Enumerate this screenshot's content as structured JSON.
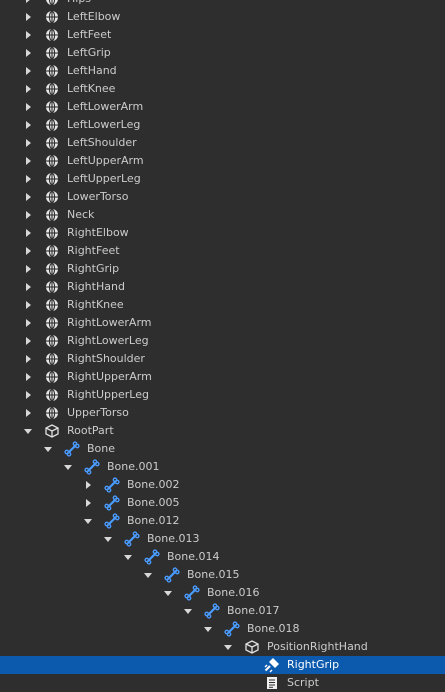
{
  "tree": {
    "items": [
      {
        "label": "Hips",
        "icon": "attachment-icon",
        "indent": 1,
        "arrow": "right"
      },
      {
        "label": "LeftElbow",
        "icon": "attachment-icon",
        "indent": 1,
        "arrow": "right"
      },
      {
        "label": "LeftFeet",
        "icon": "attachment-icon",
        "indent": 1,
        "arrow": "right"
      },
      {
        "label": "LeftGrip",
        "icon": "attachment-icon",
        "indent": 1,
        "arrow": "right"
      },
      {
        "label": "LeftHand",
        "icon": "attachment-icon",
        "indent": 1,
        "arrow": "right"
      },
      {
        "label": "LeftKnee",
        "icon": "attachment-icon",
        "indent": 1,
        "arrow": "right"
      },
      {
        "label": "LeftLowerArm",
        "icon": "attachment-icon",
        "indent": 1,
        "arrow": "right"
      },
      {
        "label": "LeftLowerLeg",
        "icon": "attachment-icon",
        "indent": 1,
        "arrow": "right"
      },
      {
        "label": "LeftShoulder",
        "icon": "attachment-icon",
        "indent": 1,
        "arrow": "right"
      },
      {
        "label": "LeftUpperArm",
        "icon": "attachment-icon",
        "indent": 1,
        "arrow": "right"
      },
      {
        "label": "LeftUpperLeg",
        "icon": "attachment-icon",
        "indent": 1,
        "arrow": "right"
      },
      {
        "label": "LowerTorso",
        "icon": "attachment-icon",
        "indent": 1,
        "arrow": "right"
      },
      {
        "label": "Neck",
        "icon": "attachment-icon",
        "indent": 1,
        "arrow": "right"
      },
      {
        "label": "RightElbow",
        "icon": "attachment-icon",
        "indent": 1,
        "arrow": "right"
      },
      {
        "label": "RightFeet",
        "icon": "attachment-icon",
        "indent": 1,
        "arrow": "right"
      },
      {
        "label": "RightGrip",
        "icon": "attachment-icon",
        "indent": 1,
        "arrow": "right"
      },
      {
        "label": "RightHand",
        "icon": "attachment-icon",
        "indent": 1,
        "arrow": "right"
      },
      {
        "label": "RightKnee",
        "icon": "attachment-icon",
        "indent": 1,
        "arrow": "right"
      },
      {
        "label": "RightLowerArm",
        "icon": "attachment-icon",
        "indent": 1,
        "arrow": "right"
      },
      {
        "label": "RightLowerLeg",
        "icon": "attachment-icon",
        "indent": 1,
        "arrow": "right"
      },
      {
        "label": "RightShoulder",
        "icon": "attachment-icon",
        "indent": 1,
        "arrow": "right"
      },
      {
        "label": "RightUpperArm",
        "icon": "attachment-icon",
        "indent": 1,
        "arrow": "right"
      },
      {
        "label": "RightUpperLeg",
        "icon": "attachment-icon",
        "indent": 1,
        "arrow": "right"
      },
      {
        "label": "UpperTorso",
        "icon": "attachment-icon",
        "indent": 1,
        "arrow": "right"
      },
      {
        "label": "RootPart",
        "icon": "part-icon",
        "indent": 1,
        "arrow": "down"
      },
      {
        "label": "Bone",
        "icon": "bone-icon",
        "indent": 2,
        "arrow": "down"
      },
      {
        "label": "Bone.001",
        "icon": "bone-icon",
        "indent": 3,
        "arrow": "down"
      },
      {
        "label": "Bone.002",
        "icon": "bone-icon",
        "indent": 4,
        "arrow": "right"
      },
      {
        "label": "Bone.005",
        "icon": "bone-icon",
        "indent": 4,
        "arrow": "right"
      },
      {
        "label": "Bone.012",
        "icon": "bone-icon",
        "indent": 4,
        "arrow": "down"
      },
      {
        "label": "Bone.013",
        "icon": "bone-icon",
        "indent": 5,
        "arrow": "down"
      },
      {
        "label": "Bone.014",
        "icon": "bone-icon",
        "indent": 6,
        "arrow": "down"
      },
      {
        "label": "Bone.015",
        "icon": "bone-icon",
        "indent": 7,
        "arrow": "down"
      },
      {
        "label": "Bone.016",
        "icon": "bone-icon",
        "indent": 8,
        "arrow": "down"
      },
      {
        "label": "Bone.017",
        "icon": "bone-icon",
        "indent": 9,
        "arrow": "down"
      },
      {
        "label": "Bone.018",
        "icon": "bone-icon",
        "indent": 10,
        "arrow": "down"
      },
      {
        "label": "PositionRightHand",
        "icon": "part-icon",
        "indent": 11,
        "arrow": "down"
      },
      {
        "label": "RightGrip",
        "icon": "weld-icon",
        "indent": 12,
        "arrow": "none",
        "selected": true
      },
      {
        "label": "Script",
        "icon": "script-icon",
        "indent": 12,
        "arrow": "none"
      }
    ]
  },
  "colors": {
    "background": "#2e2e2e",
    "text": "#cccccc",
    "selected_background": "#0b5aae",
    "bone_icon": "#4a9bff"
  }
}
